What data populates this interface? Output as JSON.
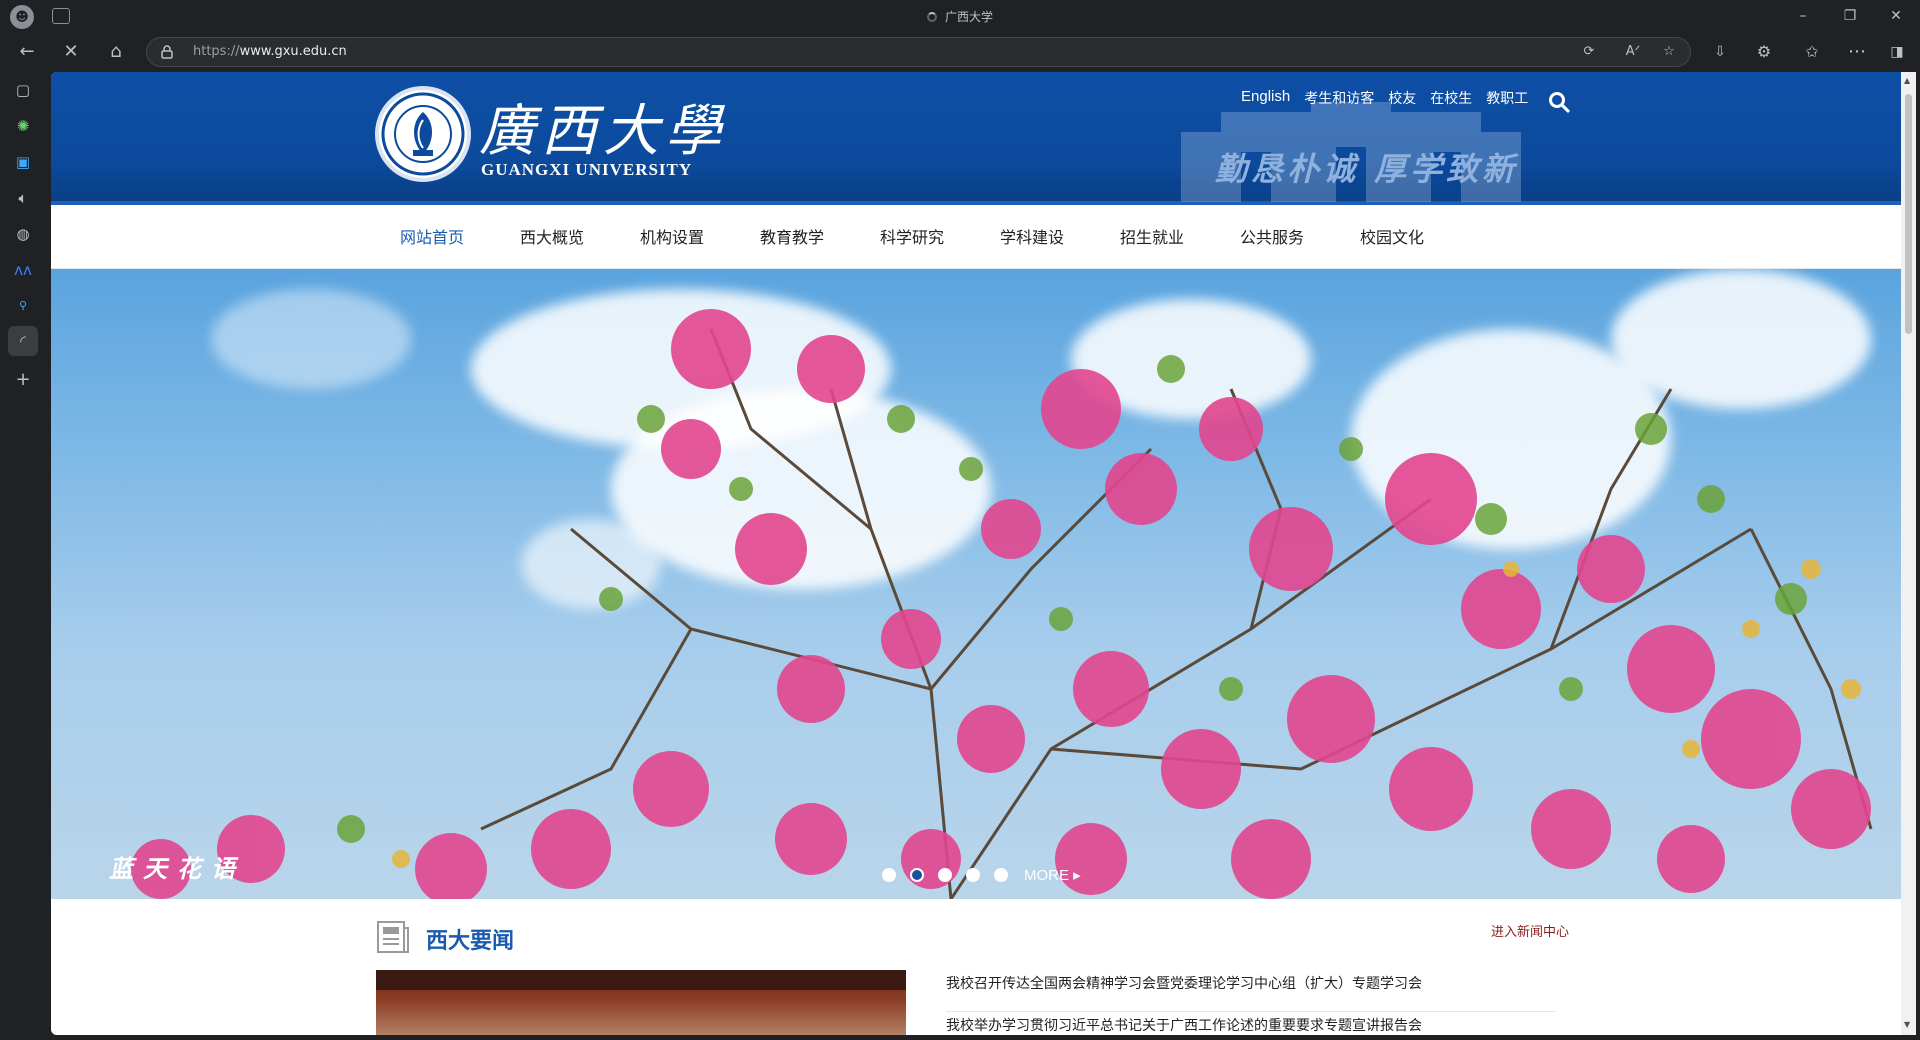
{
  "browser": {
    "tab_title": "广西大学",
    "url_proto": "https://",
    "url_host": "www.gxu.edu.cn"
  },
  "header": {
    "logo_cn": "廣西大學",
    "logo_en": "GUANGXI UNIVERSITY",
    "motto": "勤恳朴诚 厚学致新",
    "links": [
      "English",
      "考生和访客",
      "校友",
      "在校生",
      "教职工"
    ]
  },
  "nav": {
    "items": [
      "网站首页",
      "西大概览",
      "机构设置",
      "教育教学",
      "科学研究",
      "学科建设",
      "招生就业",
      "公共服务",
      "校园文化"
    ]
  },
  "banner": {
    "caption": "蓝天花语",
    "more_label": "MORE",
    "slide_count": 5,
    "active_slide": 2
  },
  "news": {
    "title": "西大要闻",
    "more_link": "进入新闻中心",
    "items": [
      "我校召开传达全国两会精神学习会暨党委理论学习中心组（扩大）专题学习会",
      "我校举办学习贯彻习近平总书记关于广西工作论述的重要要求专题宣讲报告会"
    ]
  },
  "colors": {
    "header_blue": "#0b4a9c",
    "nav_active": "#1a5bb0",
    "news_more": "#8b1c1c"
  }
}
